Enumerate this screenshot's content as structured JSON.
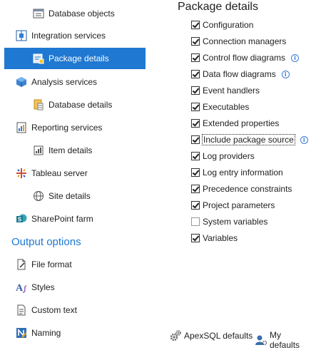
{
  "sidebar": {
    "items": [
      {
        "label": "Database objects",
        "icon": "database-objects-icon"
      },
      {
        "label": "Integration services",
        "icon": "integration-services-icon"
      },
      {
        "label": "Package details",
        "icon": "package-details-icon",
        "selected": true
      },
      {
        "label": "Analysis services",
        "icon": "analysis-services-icon"
      },
      {
        "label": "Database details",
        "icon": "database-details-icon"
      },
      {
        "label": "Reporting services",
        "icon": "reporting-services-icon"
      },
      {
        "label": "Item details",
        "icon": "item-details-icon"
      },
      {
        "label": "Tableau server",
        "icon": "tableau-server-icon"
      },
      {
        "label": "Site details",
        "icon": "site-details-icon"
      },
      {
        "label": "SharePoint farm",
        "icon": "sharepoint-farm-icon"
      }
    ],
    "output_options": {
      "title": "Output options",
      "items": [
        {
          "label": "File format",
          "icon": "file-format-icon"
        },
        {
          "label": "Styles",
          "icon": "styles-icon"
        },
        {
          "label": "Custom text",
          "icon": "custom-text-icon"
        },
        {
          "label": "Naming",
          "icon": "naming-icon"
        }
      ]
    }
  },
  "panel": {
    "title": "Package details",
    "options": [
      {
        "label": "Configuration",
        "checked": true
      },
      {
        "label": "Connection managers",
        "checked": true
      },
      {
        "label": "Control flow diagrams",
        "checked": true,
        "info": true
      },
      {
        "label": "Data flow diagrams",
        "checked": true,
        "info": true
      },
      {
        "label": "Event handlers",
        "checked": true
      },
      {
        "label": "Executables",
        "checked": true
      },
      {
        "label": "Extended properties",
        "checked": true
      },
      {
        "label": "Include package source",
        "checked": true,
        "info": true,
        "focused": true
      },
      {
        "label": "Log providers",
        "checked": true
      },
      {
        "label": "Log entry information",
        "checked": true
      },
      {
        "label": "Precedence constraints",
        "checked": true
      },
      {
        "label": "Project parameters",
        "checked": true
      },
      {
        "label": "System variables",
        "checked": false
      },
      {
        "label": "Variables",
        "checked": true
      }
    ]
  },
  "footer": {
    "apexsql_defaults": "ApexSQL defaults",
    "my_defaults": "My defaults"
  },
  "colors": {
    "accent": "#1f78d1",
    "selected_text": "#ffffff"
  }
}
